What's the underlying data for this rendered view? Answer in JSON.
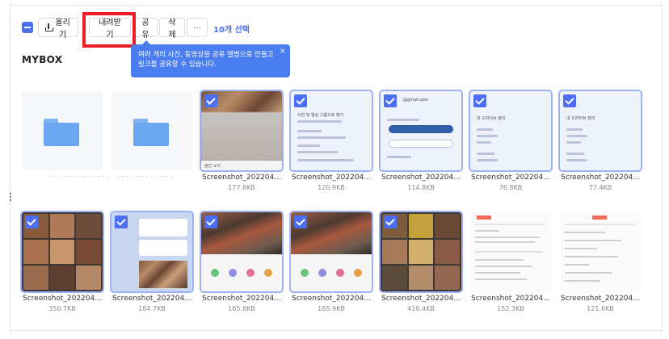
{
  "toolbar": {
    "upload_label": "올리기",
    "download_label": "내려받기",
    "share_label": "공유",
    "delete_label": "삭제",
    "more_label": "···",
    "selection_count": "10개 선택"
  },
  "tooltip": {
    "line1": "여러 개의 사진, 동영상을 공유 앨범으로 만들고",
    "line2": "링크를 공유할 수 있습니다.",
    "close": "×"
  },
  "page": {
    "title": "MYBOX"
  },
  "colors": {
    "accent": "#4b6ef5",
    "highlight": "#ee1c25",
    "tooltip": "#4a7ef0",
    "folder": "#6aa7ef"
  },
  "items": [
    {
      "type": "folder",
      "name": "",
      "size": ""
    },
    {
      "type": "folder",
      "name": "",
      "size": ""
    },
    {
      "type": "image",
      "name": "Screenshot_20220422-...",
      "size": "177.8KB",
      "selected": true,
      "thumb_text": "불판 요리"
    },
    {
      "type": "image",
      "name": "Screenshot_20220422-...",
      "size": "120.9KB",
      "selected": true,
      "thumb_text": "사진 및 영상 그룹으로 찾기"
    },
    {
      "type": "image",
      "name": "Screenshot_20220422-...",
      "size": "114.8KB",
      "selected": true,
      "thumb_text": "@gmail.com"
    },
    {
      "type": "image",
      "name": "Screenshot_20220422-...",
      "size": "76.8KB",
      "selected": true,
      "thumb_text": "내 드라이브 정리"
    },
    {
      "type": "image",
      "name": "Screenshot_20220422-...",
      "size": "77.4KB",
      "selected": true,
      "thumb_text": "내 드라이브 정리"
    },
    {
      "type": "image",
      "name": "Screenshot_20220422-...",
      "size": "350.7KB",
      "selected": true
    },
    {
      "type": "image",
      "name": "Screenshot_20220422-...",
      "size": "184.7KB",
      "selected": true
    },
    {
      "type": "image",
      "name": "Screenshot_20220422-...",
      "size": "165.8KB",
      "selected": true
    },
    {
      "type": "image",
      "name": "Screenshot_20220422-...",
      "size": "165.9KB",
      "selected": true
    },
    {
      "type": "image",
      "name": "Screenshot_20220422-...",
      "size": "410.4KB",
      "selected": true
    },
    {
      "type": "image",
      "name": "Screenshot_20220421-...",
      "size": "152.3KB",
      "selected": false
    },
    {
      "type": "image",
      "name": "Screenshot_20220421-...",
      "size": "121.6KB",
      "selected": false
    }
  ]
}
